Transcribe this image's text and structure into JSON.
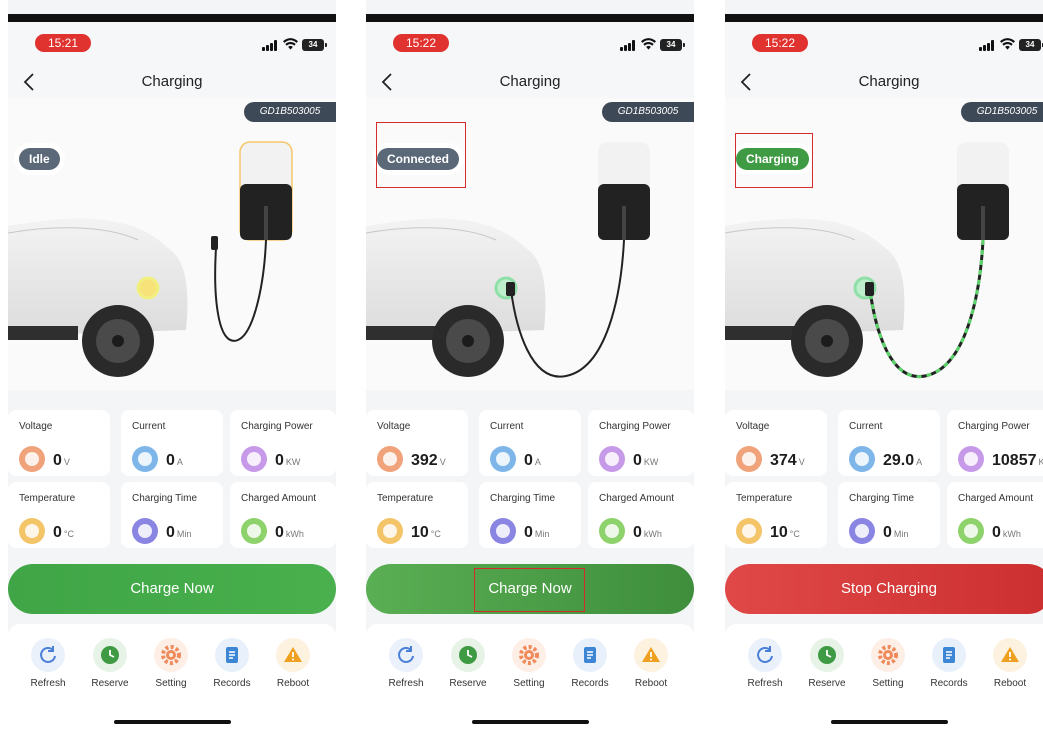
{
  "screens": [
    {
      "time": "15:21",
      "battery": "34",
      "title": "Charging",
      "device_id": "GD1B503005",
      "status": "Idle",
      "metrics": [
        {
          "label": "Voltage",
          "value": "0",
          "unit": "V",
          "icon": "voltage-icon",
          "color": "#f0a37a"
        },
        {
          "label": "Current",
          "value": "0",
          "unit": "A",
          "icon": "current-icon",
          "color": "#7fb6ea"
        },
        {
          "label": "Charging Power",
          "value": "0",
          "unit": "KW",
          "icon": "power-icon",
          "color": "#c79ae9"
        },
        {
          "label": "Temperature",
          "value": "0",
          "unit": "°C",
          "icon": "temperature-icon",
          "color": "#f4c468"
        },
        {
          "label": "Charging Time",
          "value": "0",
          "unit": "Min",
          "icon": "clock-icon",
          "color": "#8a84e2"
        },
        {
          "label": "Charged Amount",
          "value": "0",
          "unit": "kWh",
          "icon": "bolt-icon",
          "color": "#8ed26b"
        }
      ],
      "action_label": "Charge Now"
    },
    {
      "time": "15:22",
      "battery": "34",
      "title": "Charging",
      "device_id": "GD1B503005",
      "status": "Connected",
      "metrics": [
        {
          "label": "Voltage",
          "value": "392",
          "unit": "V",
          "icon": "voltage-icon",
          "color": "#f0a37a"
        },
        {
          "label": "Current",
          "value": "0",
          "unit": "A",
          "icon": "current-icon",
          "color": "#7fb6ea"
        },
        {
          "label": "Charging Power",
          "value": "0",
          "unit": "KW",
          "icon": "power-icon",
          "color": "#c79ae9"
        },
        {
          "label": "Temperature",
          "value": "10",
          "unit": "°C",
          "icon": "temperature-icon",
          "color": "#f4c468"
        },
        {
          "label": "Charging Time",
          "value": "0",
          "unit": "Min",
          "icon": "clock-icon",
          "color": "#8a84e2"
        },
        {
          "label": "Charged Amount",
          "value": "0",
          "unit": "kWh",
          "icon": "bolt-icon",
          "color": "#8ed26b"
        }
      ],
      "action_label": "Charge Now"
    },
    {
      "time": "15:22",
      "battery": "34",
      "title": "Charging",
      "device_id": "GD1B503005",
      "status": "Charging",
      "metrics": [
        {
          "label": "Voltage",
          "value": "374",
          "unit": "V",
          "icon": "voltage-icon",
          "color": "#f0a37a"
        },
        {
          "label": "Current",
          "value": "29.0",
          "unit": "A",
          "icon": "current-icon",
          "color": "#7fb6ea"
        },
        {
          "label": "Charging Power",
          "value": "10857",
          "unit": "KW",
          "icon": "power-icon",
          "color": "#c79ae9"
        },
        {
          "label": "Temperature",
          "value": "10",
          "unit": "°C",
          "icon": "temperature-icon",
          "color": "#f4c468"
        },
        {
          "label": "Charging Time",
          "value": "0",
          "unit": "Min",
          "icon": "clock-icon",
          "color": "#8a84e2"
        },
        {
          "label": "Charged Amount",
          "value": "0",
          "unit": "kWh",
          "icon": "bolt-icon",
          "color": "#8ed26b"
        }
      ],
      "action_label": "Stop Charging"
    }
  ],
  "toolbar": [
    {
      "label": "Refresh",
      "icon": "refresh-icon",
      "color": "#4a7fd8"
    },
    {
      "label": "Reserve",
      "icon": "reserve-clock-icon",
      "color": "#3f9a44"
    },
    {
      "label": "Setting",
      "icon": "gear-icon",
      "color": "#f08a5a"
    },
    {
      "label": "Records",
      "icon": "records-icon",
      "color": "#3d86d6"
    },
    {
      "label": "Reboot",
      "icon": "warning-icon",
      "color": "#f0a020"
    }
  ]
}
